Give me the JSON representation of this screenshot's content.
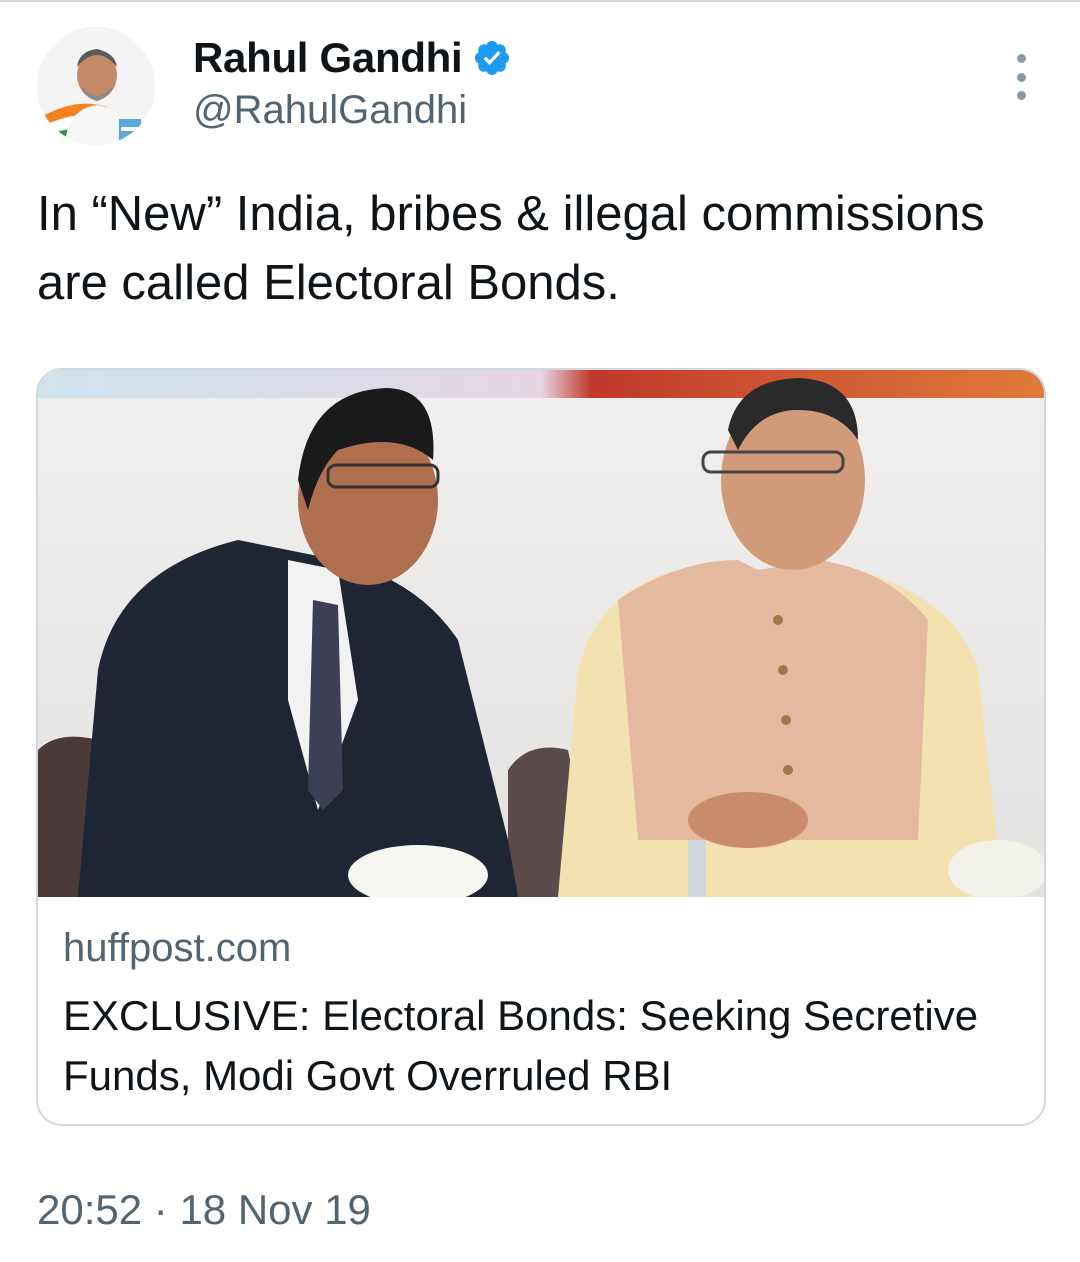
{
  "author": {
    "display_name": "Rahul Gandhi",
    "handle": "@RahulGandhi",
    "verified_icon": "verified-badge-icon",
    "avatar_icon": "avatar-photo"
  },
  "tweet": {
    "text": "In “New” India, bribes & illegal commissions are called Electoral Bonds."
  },
  "link_card": {
    "domain": "huffpost.com",
    "title": "EXCLUSIVE: Electoral Bonds: Seeking Secretive Funds, Modi Govt Overruled RBI",
    "image_icon": "article-photo"
  },
  "meta": {
    "time": "20:52",
    "separator": "·",
    "date": "18 Nov 19"
  },
  "colors": {
    "text_primary": "#0f1419",
    "text_secondary": "#536471",
    "verified_blue": "#1d9bf0",
    "border": "#cfd9de"
  }
}
